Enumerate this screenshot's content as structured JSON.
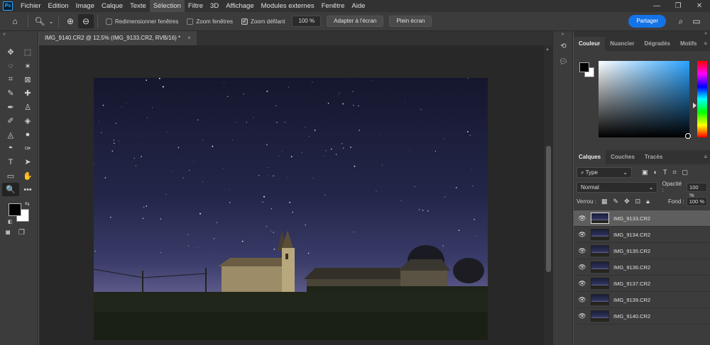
{
  "app": {
    "logo": "Ps"
  },
  "menu": [
    "Fichier",
    "Edition",
    "Image",
    "Calque",
    "Texte",
    "Sélection",
    "Filtre",
    "3D",
    "Affichage",
    "Modules externes",
    "Fenêtre",
    "Aide"
  ],
  "menu_active_index": 5,
  "window_controls": [
    "—",
    "❐",
    "✕"
  ],
  "options": {
    "home_icon": "home-icon",
    "tool_icon": "zoom-icon",
    "zoom_in_icon": "zoom-in-icon",
    "zoom_out_icon": "zoom-out-icon",
    "resize_windows": {
      "label": "Redimensionner fenêtres",
      "checked": false
    },
    "zoom_all_windows": {
      "label": "Zoom fenêtres",
      "checked": false
    },
    "scrubby_zoom": {
      "label": "Zoom défilant",
      "checked": true
    },
    "zoom_value": "100 %",
    "fit_screen_label": "Adapter à l'écran",
    "fill_screen_label": "Plein écran",
    "share_label": "Partager",
    "share_color": "#1473e6"
  },
  "document": {
    "tab_title": "IMG_9140.CR2 @ 12,5% (IMG_9133.CR2, RVB/16) *",
    "close_glyph": "×"
  },
  "tools": [
    "move-icon",
    "marquee-icon",
    "lasso-icon",
    "magic-wand-icon",
    "crop-icon",
    "frame-icon",
    "eyedropper-icon",
    "healing-icon",
    "brush-icon",
    "stamp-icon",
    "history-brush-icon",
    "eraser-icon",
    "bucket-icon",
    "blur-icon",
    "dodge-icon",
    "pen-icon",
    "type-icon",
    "path-select-icon",
    "rectangle-icon",
    "hand-icon",
    "zoom-icon",
    "more-icon"
  ],
  "tool_glyphs": [
    "✥",
    "⬚",
    "◌",
    "✶",
    "⌗",
    "⊠",
    "✎",
    "✚",
    "✒",
    "♙",
    "✐",
    "◈",
    "◬",
    "●",
    "◓",
    "✑",
    "T",
    "➤",
    "▭",
    "✋",
    "🔍",
    "•••"
  ],
  "active_tool_index": 20,
  "colors": {
    "foreground": "#000000",
    "background": "#ffffff"
  },
  "color_panel": {
    "tabs": [
      "Couleur",
      "Nuancier",
      "Dégradés",
      "Motifs"
    ],
    "active": 0
  },
  "layers_panel": {
    "tabs": [
      "Calques",
      "Couches",
      "Tracés"
    ],
    "active": 0,
    "filter_label": "Type",
    "blend_mode": "Normal",
    "opacity_label": "Opacité :",
    "opacity_value": "100 %",
    "lock_label": "Verrou :",
    "fill_label": "Fond :",
    "fill_value": "100 %",
    "layers": [
      {
        "name": "IMG_9133.CR2",
        "selected": true
      },
      {
        "name": "IMG_9134.CR2",
        "selected": false
      },
      {
        "name": "IMG_9135.CR2",
        "selected": false
      },
      {
        "name": "IMG_9136.CR2",
        "selected": false
      },
      {
        "name": "IMG_9137.CR2",
        "selected": false
      },
      {
        "name": "IMG_9139.CR2",
        "selected": false
      },
      {
        "name": "IMG_9140.CR2",
        "selected": false
      }
    ]
  }
}
